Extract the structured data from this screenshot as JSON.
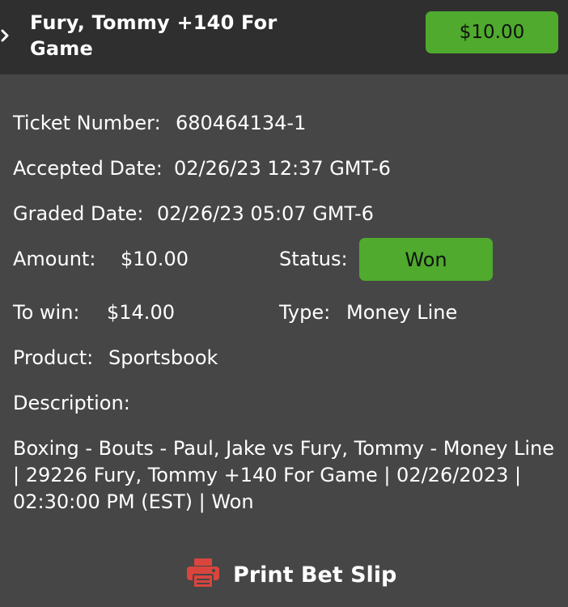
{
  "header": {
    "title": "Fury, Tommy +140 For Game",
    "amount_button": "$10.00"
  },
  "ticket": {
    "ticket_number_label": "Ticket Number:",
    "ticket_number": "680464134-1",
    "accepted_date_label": "Accepted Date:",
    "accepted_date": "02/26/23 12:37 GMT-6",
    "graded_date_label": "Graded Date:",
    "graded_date": "02/26/23 05:07 GMT-6",
    "amount_label": "Amount:",
    "amount": "$10.00",
    "status_label": "Status:",
    "status": "Won",
    "to_win_label": "To win:",
    "to_win": "$14.00",
    "type_label": "Type:",
    "type": "Money Line",
    "product_label": "Product:",
    "product": "Sportsbook",
    "description_label": "Description:",
    "description": "Boxing - Bouts - Paul, Jake vs Fury, Tommy - Money Line | 29226 Fury, Tommy +140 For Game | 02/26/2023 | 02:30:00 PM (EST) | Won"
  },
  "print": {
    "label": "Print Bet Slip"
  },
  "colors": {
    "header_bg": "#2f2f2f",
    "page_bg": "#464646",
    "accent_green": "#4faa2e",
    "print_icon_red": "#d9453d"
  },
  "icons": {
    "chevron": "chevron-right-icon",
    "print": "printer-icon"
  }
}
